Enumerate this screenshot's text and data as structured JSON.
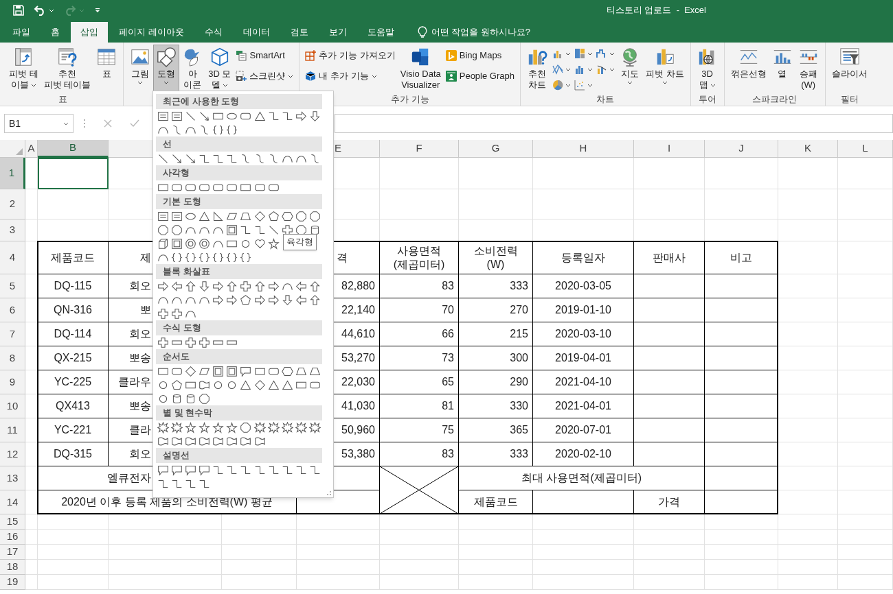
{
  "window": {
    "title": "티스토리 업로드  -  Excel"
  },
  "quick_access": [
    {
      "kind": "save",
      "disabled": false
    },
    {
      "kind": "undo",
      "disabled": false
    },
    {
      "kind": "redo",
      "disabled": true
    },
    {
      "kind": "customize",
      "disabled": false
    }
  ],
  "tabs": [
    {
      "label": "파일",
      "selected": false
    },
    {
      "label": "홈",
      "selected": false
    },
    {
      "label": "삽입",
      "selected": true
    },
    {
      "label": "페이지 레이아웃",
      "selected": false
    },
    {
      "label": "수식",
      "selected": false
    },
    {
      "label": "데이터",
      "selected": false
    },
    {
      "label": "검토",
      "selected": false
    },
    {
      "label": "보기",
      "selected": false
    },
    {
      "label": "도움말",
      "selected": false
    }
  ],
  "tell_me": {
    "placeholder": "어떤 작업을 원하시나요?"
  },
  "ribbon": {
    "groups": [
      {
        "label": "표",
        "items": [
          {
            "kind": "large",
            "label": "피벗 테\n이블",
            "dropdown": true,
            "pressed": false
          },
          {
            "kind": "large",
            "label": "추천\n피벗 테이블",
            "dropdown": false,
            "pressed": false
          },
          {
            "kind": "large",
            "label": "표",
            "dropdown": false,
            "pressed": false
          }
        ]
      },
      {
        "items": [
          {
            "kind": "large",
            "label": "그림",
            "dropdown": true,
            "pressed": false
          },
          {
            "kind": "large",
            "label": "도형",
            "dropdown": true,
            "pressed": true
          },
          {
            "kind": "large",
            "label": "아\n이콘",
            "dropdown": false,
            "pressed": false
          },
          {
            "kind": "large",
            "label": "3D 모\n델",
            "dropdown": true,
            "pressed": false
          },
          {
            "kind": "small",
            "label": "SmartArt",
            "dropdown": false,
            "pressed": false
          },
          {
            "kind": "small",
            "label": "스크린샷",
            "dropdown": true,
            "pressed": false
          }
        ]
      },
      {
        "label": "추가 기능",
        "items": [
          {
            "kind": "small",
            "label": "추가 기능 가져오기",
            "dropdown": false,
            "pressed": false
          },
          {
            "kind": "small",
            "label": "내 추가 기능",
            "dropdown": true,
            "pressed": false
          },
          {
            "kind": "large",
            "label": "Visio Data\nVisualizer",
            "dropdown": false,
            "pressed": false
          },
          {
            "kind": "small",
            "label": "Bing Maps",
            "dropdown": false,
            "pressed": false
          },
          {
            "kind": "small",
            "label": "People Graph",
            "dropdown": false,
            "pressed": false
          }
        ]
      },
      {
        "label": "차트",
        "items": [
          {
            "kind": "large",
            "label": "추천\n차트",
            "dropdown": false,
            "pressed": false
          },
          {
            "kind": "chart-gallery"
          },
          {
            "kind": "large",
            "label": "지도",
            "dropdown": true,
            "pressed": false
          },
          {
            "kind": "large",
            "label": "피벗 차트",
            "dropdown": true,
            "pressed": false
          }
        ]
      },
      {
        "label": "투어",
        "items": [
          {
            "kind": "large",
            "label": "3D\n맵",
            "dropdown": true,
            "pressed": false
          }
        ]
      },
      {
        "label": "스파크라인",
        "items": [
          {
            "kind": "large",
            "label": "꺾은선형",
            "dropdown": false,
            "pressed": false
          },
          {
            "kind": "large",
            "label": "열",
            "dropdown": false,
            "pressed": false
          },
          {
            "kind": "large",
            "label": "승패\n(W)",
            "dropdown": false,
            "pressed": false
          }
        ]
      },
      {
        "label": "필터",
        "items": [
          {
            "kind": "large",
            "label": "슬라이서",
            "dropdown": false,
            "pressed": false
          }
        ]
      }
    ]
  },
  "name_box": {
    "value": "B1"
  },
  "formula_bar": {
    "editing": false
  },
  "shapes_menu": {
    "sections": [
      {
        "title": "최근에 사용한 도형"
      },
      {
        "title": "선"
      },
      {
        "title": "사각형"
      },
      {
        "title": "기본 도형"
      },
      {
        "title": "블록 화살표"
      },
      {
        "title": "수식 도형"
      },
      {
        "title": "순서도"
      },
      {
        "title": "별 및 현수막"
      },
      {
        "title": "설명선"
      }
    ],
    "tooltip": "육각형"
  },
  "sheet": {
    "columns": [
      {
        "header": "A",
        "selected": false
      },
      {
        "header": "B",
        "selected": true
      },
      {
        "selected": false
      },
      {
        "header": "E",
        "selected": false
      },
      {
        "header": "F",
        "selected": false
      },
      {
        "header": "G",
        "selected": false
      },
      {
        "header": "H",
        "selected": false
      },
      {
        "header": "I",
        "selected": false
      },
      {
        "header": "J",
        "selected": false
      },
      {
        "header": "K",
        "selected": false
      },
      {
        "header": "L",
        "selected": false
      }
    ],
    "rows": [
      {
        "header": "1",
        "selected": true
      },
      {
        "header": "2",
        "selected": false
      },
      {
        "header": "3",
        "selected": false
      },
      {
        "header": "4",
        "selected": false,
        "cells": {
          "B": "제품코드",
          "C": "제",
          "E": "격",
          "F": "사용면적\n(제곱미터)",
          "G": "소비전력\n(W)",
          "H": "등록일자",
          "I": "판매사",
          "J": "비고"
        }
      },
      {
        "header": "5",
        "selected": false,
        "cells": {
          "B": "DQ-115",
          "C": "회오",
          "E": "82,880",
          "F": "83",
          "G": "333",
          "H": "2020-03-05"
        }
      },
      {
        "header": "6",
        "selected": false,
        "cells": {
          "B": "QN-316",
          "C": "뽀",
          "E": "22,140",
          "F": "70",
          "G": "270",
          "H": "2019-01-10"
        }
      },
      {
        "header": "7",
        "selected": false,
        "cells": {
          "B": "DQ-114",
          "C": "회오",
          "E": "44,610",
          "F": "66",
          "G": "215",
          "H": "2020-03-10"
        }
      },
      {
        "header": "8",
        "selected": false,
        "cells": {
          "B": "QX-215",
          "C": "뽀송",
          "E": "53,270",
          "F": "73",
          "G": "300",
          "H": "2019-04-01"
        }
      },
      {
        "header": "9",
        "selected": false,
        "cells": {
          "B": "YC-225",
          "C": "클라우",
          "E": "22,030",
          "F": "65",
          "G": "290",
          "H": "2021-04-10"
        }
      },
      {
        "header": "10",
        "selected": false,
        "cells": {
          "B": "QX413",
          "C": "뽀송",
          "E": "41,030",
          "F": "81",
          "G": "330",
          "H": "2021-04-01"
        }
      },
      {
        "header": "11",
        "selected": false,
        "cells": {
          "B": "YC-221",
          "C": "클라",
          "E": "50,960",
          "F": "75",
          "G": "365",
          "H": "2020-07-01"
        }
      },
      {
        "header": "12",
        "selected": false,
        "cells": {
          "B": "DQ-315",
          "C": "회오",
          "E": "53,380",
          "F": "83",
          "G": "333",
          "H": "2020-02-10"
        }
      },
      {
        "header": "13",
        "selected": false,
        "cells": {
          "B": "엘큐전자",
          "G": "최대 사용면적(제곱미터)"
        }
      },
      {
        "header": "14",
        "selected": false,
        "cells": {
          "B": "2020년 이후 등록 제품의 소비전력(W) 평균",
          "G": "제품코드",
          "I": "가격"
        }
      },
      {
        "header": "15",
        "selected": false
      },
      {
        "header": "16",
        "selected": false
      },
      {
        "header": "17",
        "selected": false
      },
      {
        "header": "18",
        "selected": false
      },
      {
        "header": "19",
        "selected": false
      }
    ]
  }
}
